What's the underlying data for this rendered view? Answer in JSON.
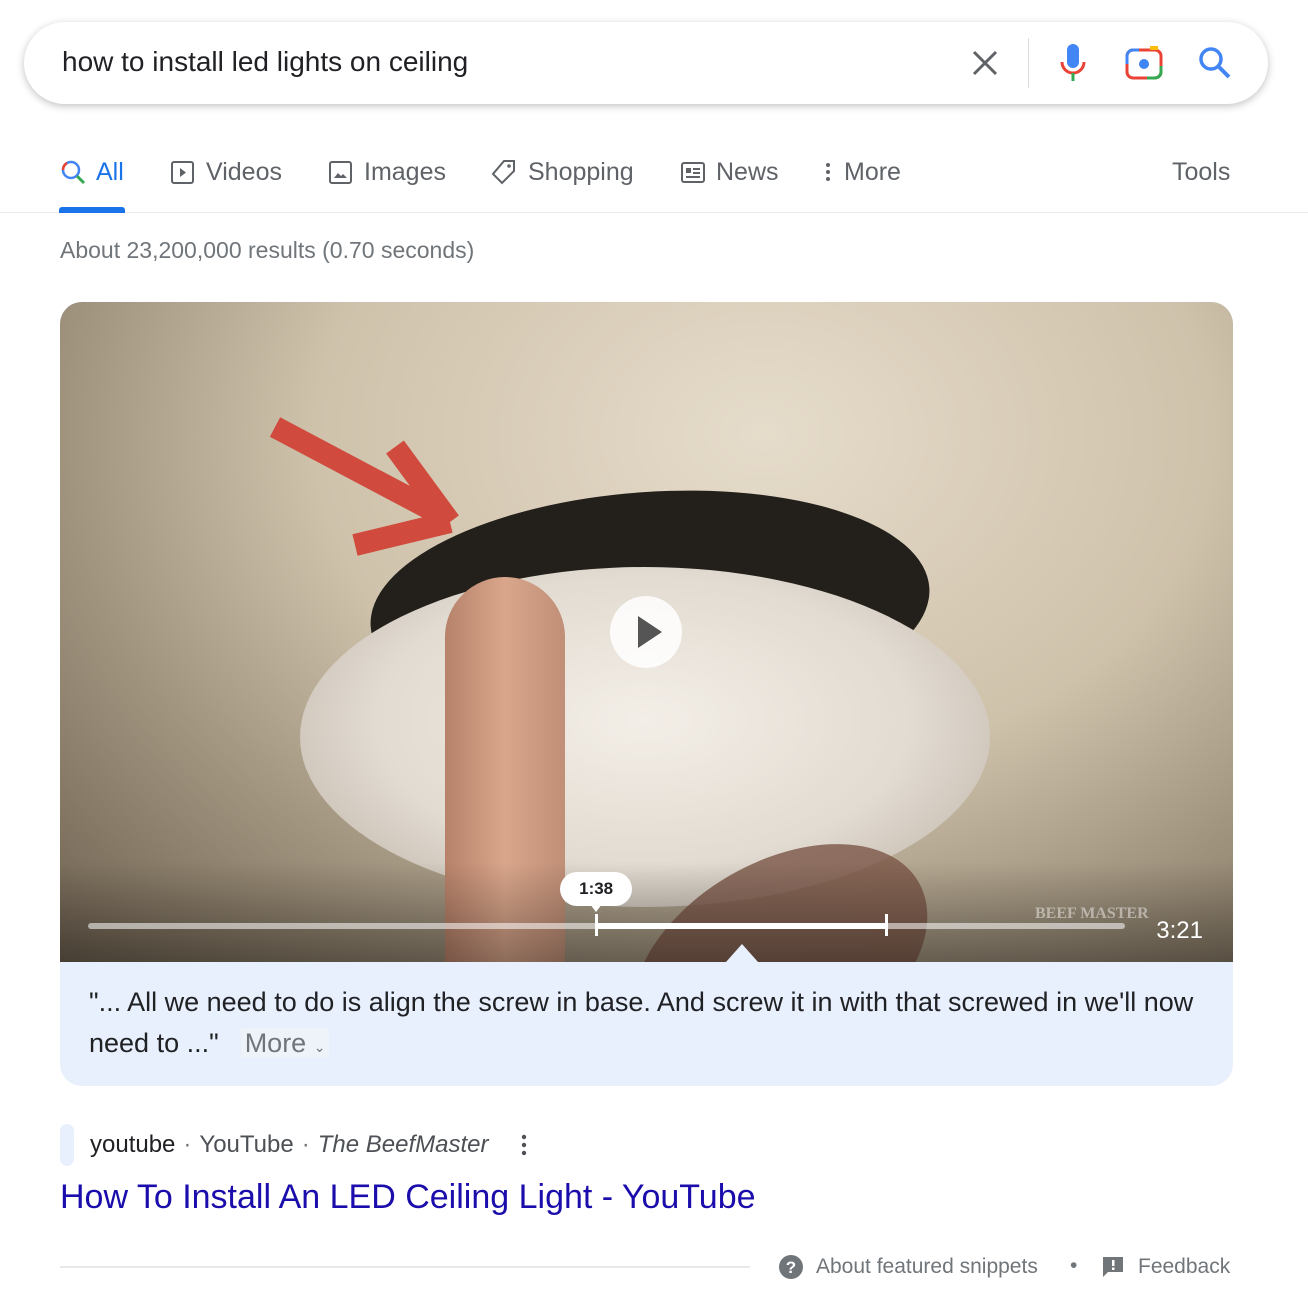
{
  "search": {
    "query": "how to install led lights on ceiling"
  },
  "tabs": [
    {
      "label": "All",
      "icon": "search-icon",
      "active": true
    },
    {
      "label": "Videos",
      "icon": "video-icon"
    },
    {
      "label": "Images",
      "icon": "image-icon"
    },
    {
      "label": "Shopping",
      "icon": "tag-icon"
    },
    {
      "label": "News",
      "icon": "news-icon"
    },
    {
      "label": "More",
      "icon": "more-vert-icon"
    }
  ],
  "tools_label": "Tools",
  "stats": "About 23,200,000 results (0.70 seconds)",
  "video": {
    "current_time": "1:38",
    "duration": "3:21",
    "progress": 0.49,
    "segment_end": 0.77,
    "watermark": "BEEF MASTER"
  },
  "snippet": {
    "text": "\"... All we need to do is align the screw in base. And screw it in with that screwed in we'll now need to ...\"",
    "more_label": "More"
  },
  "result": {
    "site": "youtube",
    "source": "YouTube",
    "author": "The BeefMaster",
    "title": "How To Install An LED Ceiling Light - YouTube"
  },
  "footer": {
    "about": "About featured snippets",
    "feedback": "Feedback"
  },
  "colors": {
    "accent": "#1a73e8",
    "link": "#1a0dab",
    "snippet_bg": "#e8f0fe"
  }
}
